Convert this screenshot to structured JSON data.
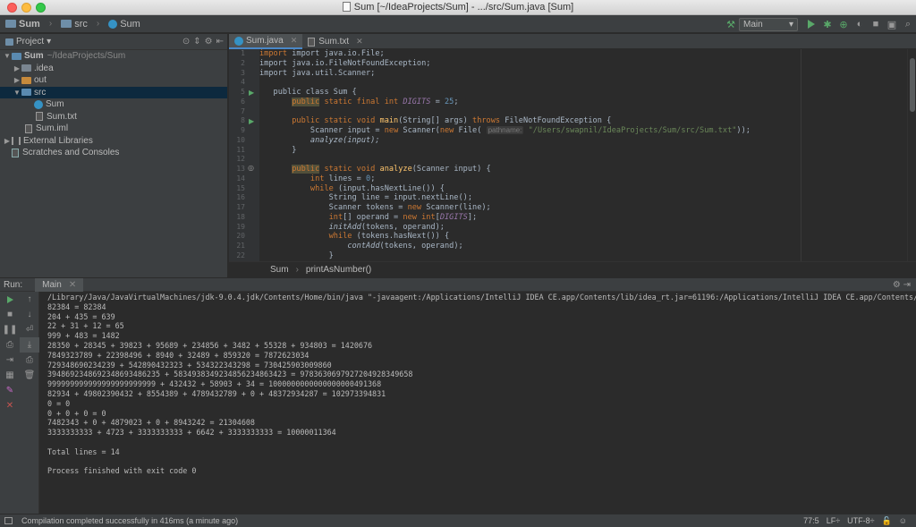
{
  "window": {
    "title": "Sum [~/IdeaProjects/Sum] - .../src/Sum.java [Sum]"
  },
  "navbar": {
    "crumbs": [
      "Sum",
      "src",
      "Sum"
    ],
    "run_config": "Main"
  },
  "project": {
    "header": "Project",
    "tree": [
      {
        "label": "Sum",
        "extra": "~/IdeaProjects/Sum",
        "depth": 0,
        "kind": "project"
      },
      {
        "label": ".idea",
        "depth": 1,
        "kind": "folder-grey"
      },
      {
        "label": "out",
        "depth": 1,
        "kind": "folder-orange"
      },
      {
        "label": "src",
        "depth": 1,
        "kind": "folder-blue"
      },
      {
        "label": "Sum",
        "depth": 2,
        "kind": "class"
      },
      {
        "label": "Sum.txt",
        "depth": 2,
        "kind": "file"
      },
      {
        "label": "Sum.iml",
        "depth": 1,
        "kind": "file"
      },
      {
        "label": "External Libraries",
        "depth": 0,
        "kind": "lib"
      },
      {
        "label": "Scratches and Consoles",
        "depth": 0,
        "kind": "scratch"
      }
    ]
  },
  "editor": {
    "tabs": [
      {
        "label": "Sum.java",
        "active": true
      },
      {
        "label": "Sum.txt",
        "active": false
      }
    ],
    "line_numbers": [
      "1",
      "2",
      "3",
      "4",
      "5",
      "6",
      "7",
      "8",
      "9",
      "10",
      "11",
      "12",
      "13",
      "14",
      "15",
      "16",
      "17",
      "18",
      "19",
      "20",
      "21",
      "22"
    ],
    "breadcrumb": [
      "Sum",
      "printAsNumber()"
    ],
    "code": {
      "l1": "import java.io.File;",
      "l2": "import java.io.FileNotFoundException;",
      "l3": "import java.util.Scanner;",
      "l5": "public class Sum {",
      "l6_kw": "public",
      "l6_rest": " static final int ",
      "l6_const": "DIGITS",
      "l6_eq": " = ",
      "l6_num": "25",
      "l8_a": "public static void ",
      "l8_fn": "main",
      "l8_b": "(String[] args) ",
      "l8_kw": "throws",
      "l8_c": " FileNotFoundException {",
      "l9_a": "Scanner input = ",
      "l9_kw": "new",
      "l9_b": " Scanner(",
      "l9_kw2": "new",
      "l9_c": " File(",
      "l9_hint": "pathname:",
      "l9_str": "\"/Users/swapnil/IdeaProjects/Sum/src/Sum.txt\"",
      "l9_d": "));",
      "l10": "analyze(input);",
      "l11": "}",
      "l13_kw": "public",
      "l13_rest": " static void ",
      "l13_fn": "analyze",
      "l13_b": "(Scanner input) {",
      "l14_kw": "int",
      "l14_a": " lines = ",
      "l14_num": "0",
      "l14_b": ";",
      "l15_kw": "while",
      "l15_a": " (input.hasNextLine()) {",
      "l16": "String line = input.nextLine();",
      "l17_a": "Scanner tokens = ",
      "l17_kw": "new",
      "l17_b": " Scanner(line);",
      "l18_kw": "int",
      "l18_a": "[] operand = ",
      "l18_kw2": "new int",
      "l18_b": "[",
      "l18_const": "DIGITS",
      "l18_c": "];",
      "l19_it": "initAdd",
      "l19_a": "(tokens, operand);",
      "l20_kw": "while",
      "l20_a": " (tokens.hasNext()) {",
      "l21_it": "contAdd",
      "l21_a": "(tokens, operand);",
      "l22": "}"
    }
  },
  "run": {
    "label": "Run:",
    "tab": "Main",
    "console": [
      "/Library/Java/JavaVirtualMachines/jdk-9.0.4.jdk/Contents/Home/bin/java \"-javaagent:/Applications/IntelliJ IDEA CE.app/Contents/lib/idea_rt.jar=61196:/Applications/IntelliJ IDEA CE.app/Contents/bi",
      "82384 = 82384",
      "204 + 435 = 639",
      "22 + 31 + 12 = 65",
      "999 + 483 = 1482",
      "28350 + 28345 + 39823 + 95689 + 234856 + 3482 + 55328 + 934803 = 1420676",
      "7849323789 + 22398496 + 8940 + 32489 + 859320 = 7872623034",
      "729348690234239 + 542890432323 + 534322343298 = 730425903009860",
      "3948692348692348693486235 + 5834938349234856234863423 = 9783630697927204928349658",
      "999999999999999999999999 + 432432 + 58903 + 34 = 1000000000000000000491368",
      "82934 + 49802390432 + 8554389 + 4789432789 + 0 + 48372934287 = 102973394831",
      "0 = 0",
      "0 + 0 + 0 = 0",
      "7482343 + 0 + 4879023 + 0 + 8943242 = 21304608",
      "3333333333 + 4723 + 3333333333 + 6642 + 3333333333 = 10000011364",
      "",
      "Total lines = 14",
      "",
      "Process finished with exit code 0"
    ]
  },
  "status": {
    "message": "Compilation completed successfully in 416ms (a minute ago)",
    "position": "77:5",
    "line_sep": "LF÷",
    "encoding": "UTF-8÷"
  }
}
